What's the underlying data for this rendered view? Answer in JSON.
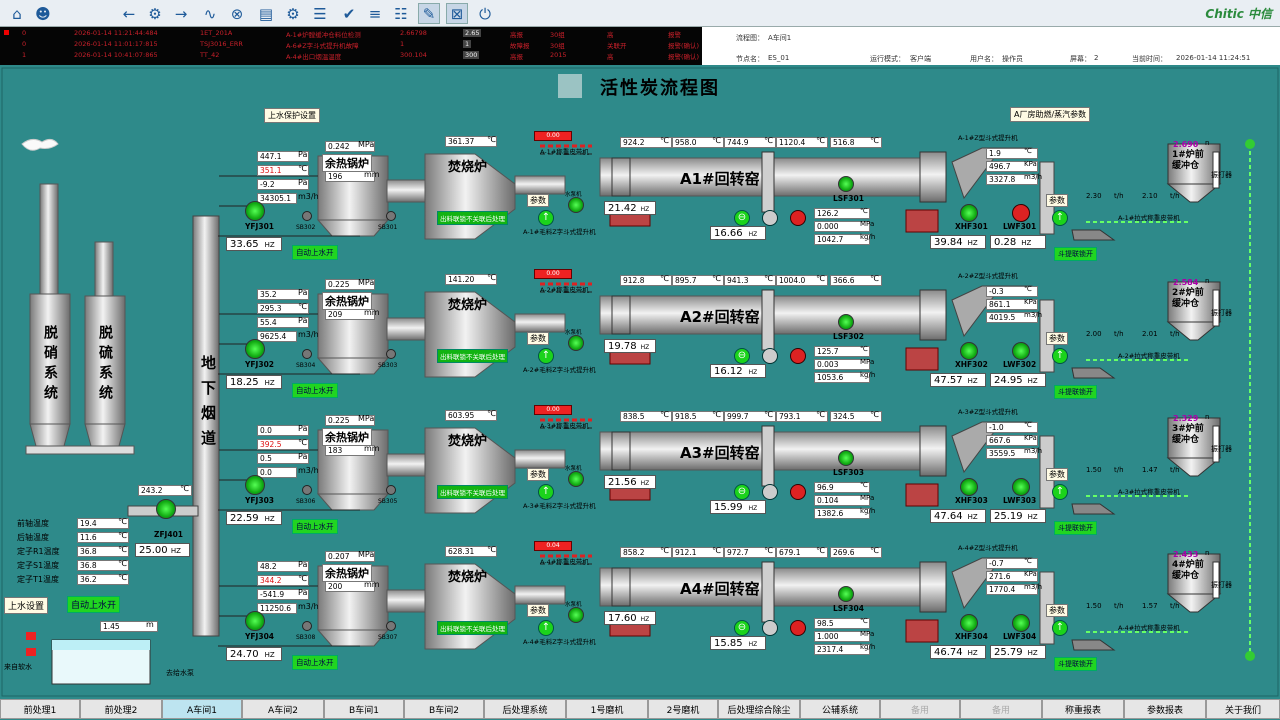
{
  "toolbar": {
    "icons": [
      "home-icon",
      "user-icon",
      "back-icon",
      "network-icon",
      "forward-icon",
      "trend-icon",
      "cancel-icon",
      "report-icon",
      "settings-icon",
      "sliders-icon",
      "check-icon",
      "list-icon",
      "stack-icon",
      "edit-icon",
      "filter-icon",
      "power-icon"
    ],
    "logo": "Chitic 中信"
  },
  "alarms": [
    [
      "0",
      "2026-01-14 11:21:44:484",
      "1ET_201A",
      "A-1#炉膛缓冲仓料位检测",
      "2.66798",
      "2.65",
      "高报",
      "30组",
      "高",
      "报警"
    ],
    [
      "0",
      "2026-01-14 11:01:17:815",
      "TSJ3016_ERR",
      "A-6#Z字斗式提升机故障",
      "1",
      "1",
      "故障报",
      "30组",
      "关联开",
      "报警(确认)"
    ],
    [
      "1",
      "2026-01-14 10:41:07:865",
      "TT_42",
      "A-4#出口烟温温度",
      "300.104",
      "300",
      "高报",
      "2015",
      "高",
      "报警(确认)"
    ]
  ],
  "info": {
    "flow_label": "流程图：",
    "flow_value": "A车间1",
    "node_label": "节点名：",
    "node_value": "ES_01",
    "mode_label": "运行模式：",
    "mode_value": "客户端",
    "user_label": "用户名：",
    "user_value": "操作员",
    "screen_label": "屏幕：",
    "screen_value": "2",
    "time_label": "当前时间：",
    "time_value": "2026-01-14 11:24:51"
  },
  "title": "活性炭流程图",
  "left": {
    "water_protect": "上水保护设置",
    "factory_param": "A厂房助燃/蒸汽参数",
    "stack1": "脱硝系统",
    "stack2": "脱硫系统",
    "flue": "地下烟道",
    "temp_value": "243.2",
    "temp_unit": "℃",
    "fan_name": "ZFJ401",
    "fan_hz": "25.00",
    "hz": "HZ",
    "motor_labels": [
      "前轴温度",
      "后轴温度",
      "定子R1温度",
      "定子S1温度",
      "定子T1温度"
    ],
    "motor_values": [
      "19.4",
      "11.6",
      "36.8",
      "36.8",
      "36.2"
    ],
    "motor_unit": "℃",
    "set_btn": "上水设置",
    "auto_btn": "自动上水开",
    "level": "1.45",
    "level_unit": "m",
    "src": "来自软水",
    "dst": "去给水泵"
  },
  "lines": [
    {
      "name": "A1#回转窑",
      "pump": "YFJ301",
      "pump_hz": "33.65",
      "sb": [
        "SB302",
        "SB301"
      ],
      "auto": "自动上水开",
      "boiler": "余热锅炉",
      "boiler_mpa": "0.242",
      "boiler_level": "196",
      "in": [
        "447.1",
        "351.1",
        "-9.2",
        "34305.1"
      ],
      "in_red": [
        false,
        true,
        false,
        false
      ],
      "furnace": "焚烧炉",
      "furnace_t": "361.37",
      "interlock": "出料联锁不关联后处理",
      "kiln_t": [
        "924.2",
        "958.0",
        "744.9",
        "1120.4",
        "516.8"
      ],
      "feed_hz": "21.42",
      "kiln_hz": "16.66",
      "lsf": "LSF301",
      "lsf_vals": [
        "126.2",
        "0.000",
        "1042.7"
      ],
      "xhf": "XHF301",
      "xhf_hz": "39.84",
      "lwf": "LWF301",
      "lwf_hz": "0.28",
      "elev": [
        "1.9",
        "496.7",
        "3327.8"
      ],
      "elev_name": "A-1#Z型斗式提升机",
      "conv": "A-1#拉式称重皮带机",
      "tph": [
        "2.30",
        "2.10"
      ],
      "bucket": "1#炉前缓冲仓",
      "bucket_val": "2.690",
      "vib": "振打器",
      "lift": "斗提联锁开",
      "param": "参数",
      "belt": "A-1#称重皮带机",
      "zlift": "A-1#毛料Z字斗式提升机",
      "redtag": "0.00"
    },
    {
      "name": "A2#回转窑",
      "pump": "YFJ302",
      "pump_hz": "18.25",
      "sb": [
        "SB304",
        "SB303"
      ],
      "auto": "自动上水开",
      "boiler": "余热锅炉",
      "boiler_mpa": "0.225",
      "boiler_level": "209",
      "in": [
        "35.2",
        "295.3",
        "55.4",
        "9625.4"
      ],
      "in_red": [
        false,
        false,
        false,
        false
      ],
      "furnace": "焚烧炉",
      "furnace_t": "141.20",
      "interlock": "出料联锁不关联后处理",
      "kiln_t": [
        "912.8",
        "895.7",
        "941.3",
        "1004.0",
        "366.6"
      ],
      "feed_hz": "19.78",
      "kiln_hz": "16.12",
      "lsf": "LSF302",
      "lsf_vals": [
        "125.7",
        "0.003",
        "1053.6"
      ],
      "xhf": "XHF302",
      "xhf_hz": "47.57",
      "lwf": "LWF302",
      "lwf_hz": "24.95",
      "elev": [
        "-0.3",
        "861.1",
        "4019.5"
      ],
      "elev_name": "A-2#Z型斗式提升机",
      "conv": "A-2#拉式称重皮带机",
      "tph": [
        "2.00",
        "2.01"
      ],
      "bucket": "2#炉前缓冲仓",
      "bucket_val": "2.584",
      "vib": "振打器",
      "lift": "斗提联锁开",
      "param": "参数",
      "belt": "A-2#称重皮带机",
      "zlift": "A-2#毛料Z字斗式提升机",
      "redtag": "0.00"
    },
    {
      "name": "A3#回转窑",
      "pump": "YFJ303",
      "pump_hz": "22.59",
      "sb": [
        "SB306",
        "SB305"
      ],
      "auto": "自动上水开",
      "boiler": "余热锅炉",
      "boiler_mpa": "0.225",
      "boiler_level": "183",
      "in": [
        "0.0",
        "392.5",
        "0.5",
        "0.0"
      ],
      "in_red": [
        false,
        true,
        false,
        false
      ],
      "furnace": "焚烧炉",
      "furnace_t": "603.95",
      "interlock": "出料联锁不关联后处理",
      "kiln_t": [
        "838.5",
        "918.5",
        "999.7",
        "793.1",
        "324.5"
      ],
      "feed_hz": "21.56",
      "kiln_hz": "15.99",
      "lsf": "LSF303",
      "lsf_vals": [
        "96.9",
        "0.104",
        "1382.6"
      ],
      "xhf": "XHF303",
      "xhf_hz": "47.64",
      "lwf": "LWF303",
      "lwf_hz": "25.19",
      "elev": [
        "-1.0",
        "667.6",
        "3559.5"
      ],
      "elev_name": "A-3#Z型斗式提升机",
      "conv": "A-3#拉式称重皮带机",
      "tph": [
        "1.50",
        "1.47"
      ],
      "bucket": "3#炉前缓冲仓",
      "bucket_val": "2.329",
      "vib": "振打器",
      "lift": "斗提联锁开",
      "param": "参数",
      "belt": "A-3#称重皮带机",
      "zlift": "A-3#毛料Z字斗式提升机",
      "redtag": "0.00"
    },
    {
      "name": "A4#回转窑",
      "pump": "YFJ304",
      "pump_hz": "24.70",
      "sb": [
        "SB308",
        "SB307"
      ],
      "auto": "自动上水开",
      "boiler": "余热锅炉",
      "boiler_mpa": "0.207",
      "boiler_level": "200",
      "in": [
        "48.2",
        "344.2",
        "-541.9",
        "11250.6"
      ],
      "in_red": [
        false,
        true,
        false,
        false
      ],
      "furnace": "焚烧炉",
      "furnace_t": "628.31",
      "interlock": "出料联锁不关联后处理",
      "kiln_t": [
        "858.2",
        "912.1",
        "972.7",
        "679.1",
        "269.6"
      ],
      "feed_hz": "17.60",
      "kiln_hz": "15.85",
      "lsf": "LSF304",
      "lsf_vals": [
        "98.5",
        "1.000",
        "2317.4"
      ],
      "xhf": "XHF304",
      "xhf_hz": "46.74",
      "lwf": "LWF304",
      "lwf_hz": "25.79",
      "elev": [
        "-0.7",
        "271.6",
        "1770.4"
      ],
      "elev_name": "A-4#Z型斗式提升机",
      "conv": "A-4#拉式称重皮带机",
      "tph": [
        "1.50",
        "1.57"
      ],
      "bucket": "4#炉前缓冲仓",
      "bucket_val": "2.433",
      "vib": "振打器",
      "lift": "斗提联锁开",
      "param": "参数",
      "belt": "A-4#称重皮带机",
      "zlift": "A-4#毛料Z字斗式提升机",
      "redtag": "0.04"
    }
  ],
  "units": {
    "pa": "Pa",
    "c": "℃",
    "mpa": "MPa",
    "mm": "mm",
    "m3h": "m3/h",
    "kpa": "KPa",
    "kgh": "kg/h",
    "tph": "t/h",
    "hz": "HZ",
    "n": "n",
    "waterpump": "水泵机"
  },
  "bottom": [
    "前处理1",
    "前处理2",
    "A车间1",
    "A车间2",
    "B车间1",
    "B车间2",
    "后处理系统",
    "1号磨机",
    "2号磨机",
    "后处理综合除尘",
    "公辅系统",
    "备用",
    "备用",
    "称重报表",
    "参数报表",
    "关于我们"
  ]
}
